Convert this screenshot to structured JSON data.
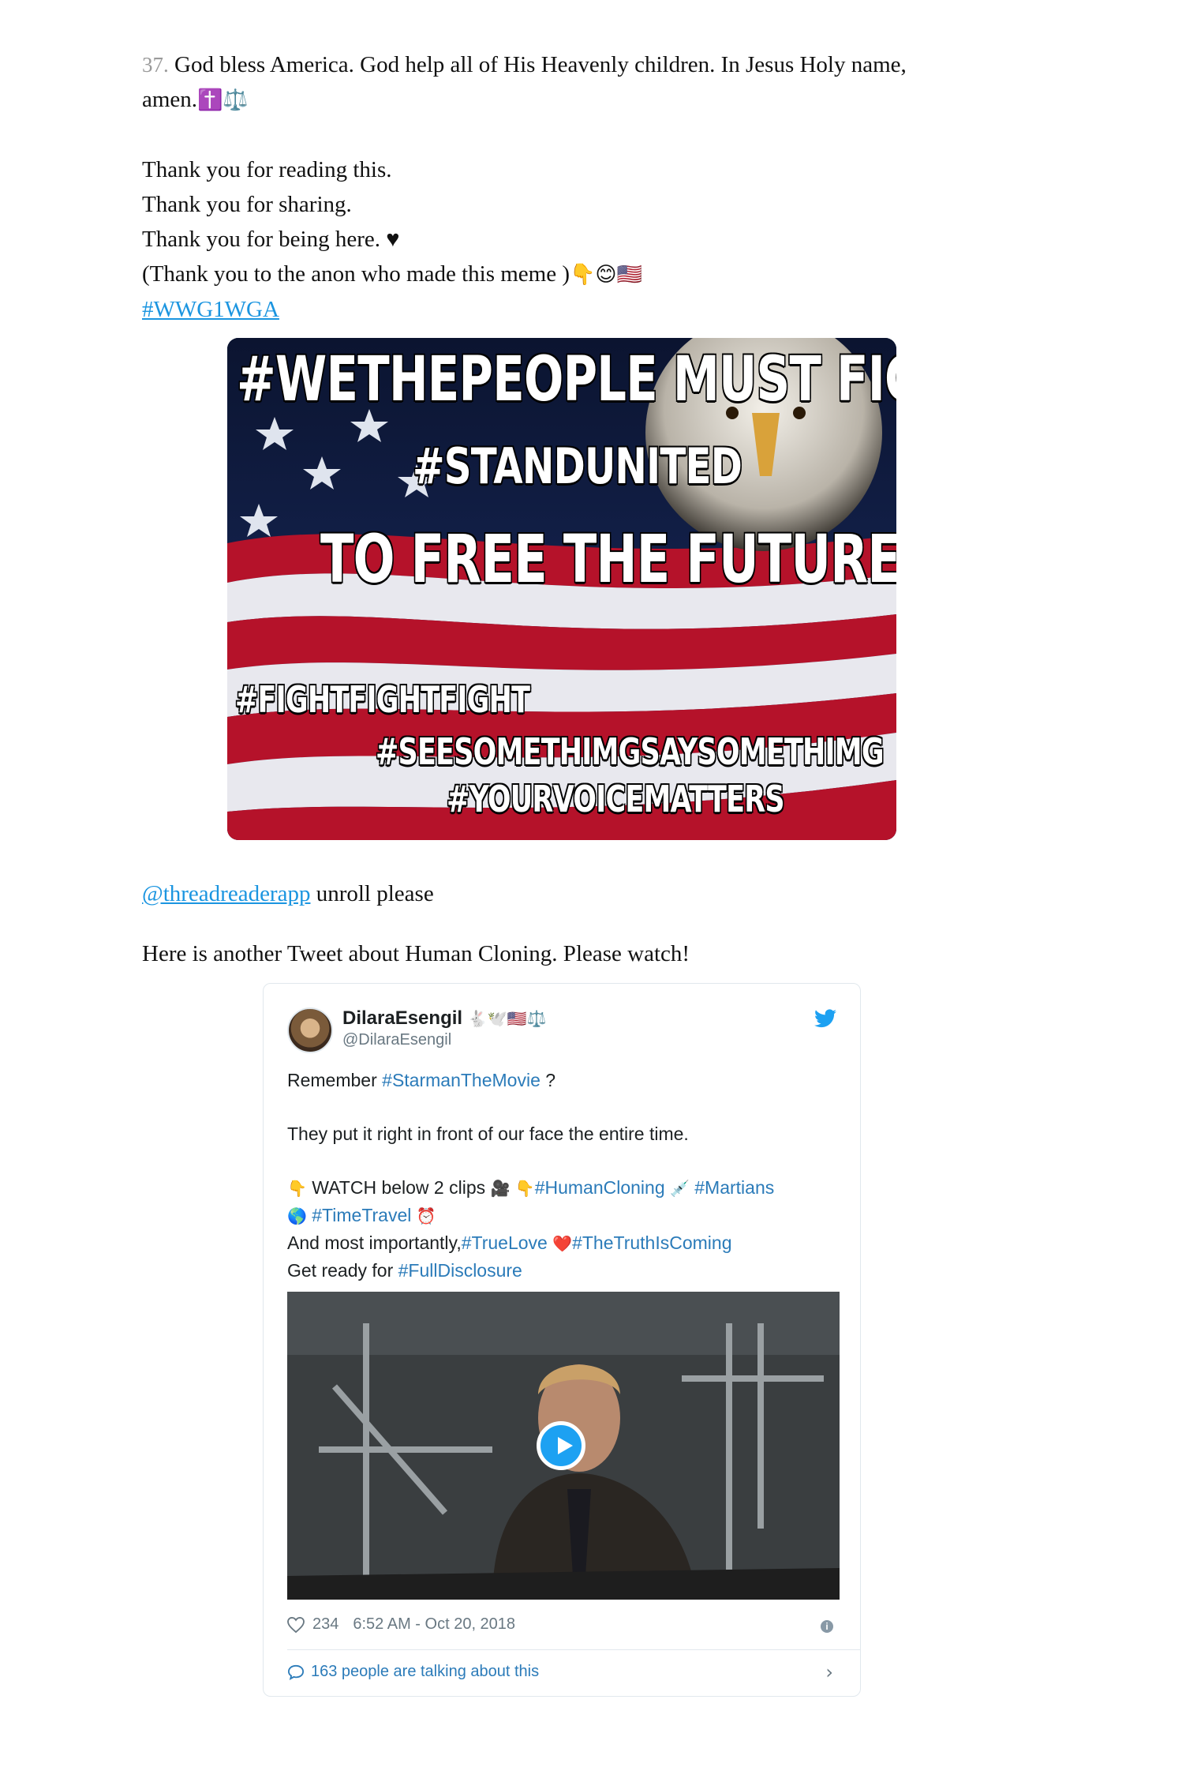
{
  "thread": {
    "number": "37.",
    "line1": "God bless America. God help all of His Heavenly children. In Jesus Holy name,",
    "line2": "amen.",
    "line2_emoji": "✝️⚖️",
    "thanks1": "Thank you for reading this.",
    "thanks2": "Thank you for sharing.",
    "thanks3": "Thank you for being here. ♥",
    "thanks4": "(Thank you to the anon who made this meme )",
    "thanks4_emoji": "👇😊🇺🇸",
    "hashtag": "#WWG1WGA"
  },
  "meme": {
    "line1": "#WETHEPEOPLE MUST FIGHT",
    "line2": "#STANDUNITED",
    "line3": "TO FREE THE FUTURE",
    "line4": "#FIGHTFIGHTFIGHT",
    "line5": "#SEESOMETHIMGSAYSOMETHIMG",
    "line6": "#YOURVOICEMATTERS"
  },
  "after": {
    "mention": "@threadreaderapp",
    "mention_rest": " unroll please",
    "another": "Here is another Tweet about Human Cloning. Please watch!"
  },
  "tweet": {
    "name": "DilaraEsengil",
    "name_emoji": "🐇🕊️🇺🇸⚖️",
    "handle": "@DilaraEsengil",
    "p1_pre": "Remember ",
    "p1_tag": "#StarmanTheMovie",
    "p1_post": " ?",
    "p2": "They put it right in front of our face the entire time.",
    "p3_e1": "👇",
    "p3_text": " WATCH below 2 clips ",
    "p3_e2": "🎥 👇",
    "p3_tag1": "#HumanCloning",
    "p3_e3": " 💉 ",
    "p3_tag2": "#Martians",
    "p4_e1": "🌎 ",
    "p4_tag": "#TimeTravel",
    "p4_e2": " ⏰",
    "p5_text": "And most importantly,",
    "p5_tag1": "#TrueLove",
    "p5_heart": " ❤️",
    "p5_tag2": "#TheTruthIsComing",
    "p6_text": "Get ready for ",
    "p6_tag": "#FullDisclosure",
    "likes": "234",
    "timestamp": "6:52 AM - Oct 20, 2018",
    "talking": "163 people are talking about this"
  }
}
